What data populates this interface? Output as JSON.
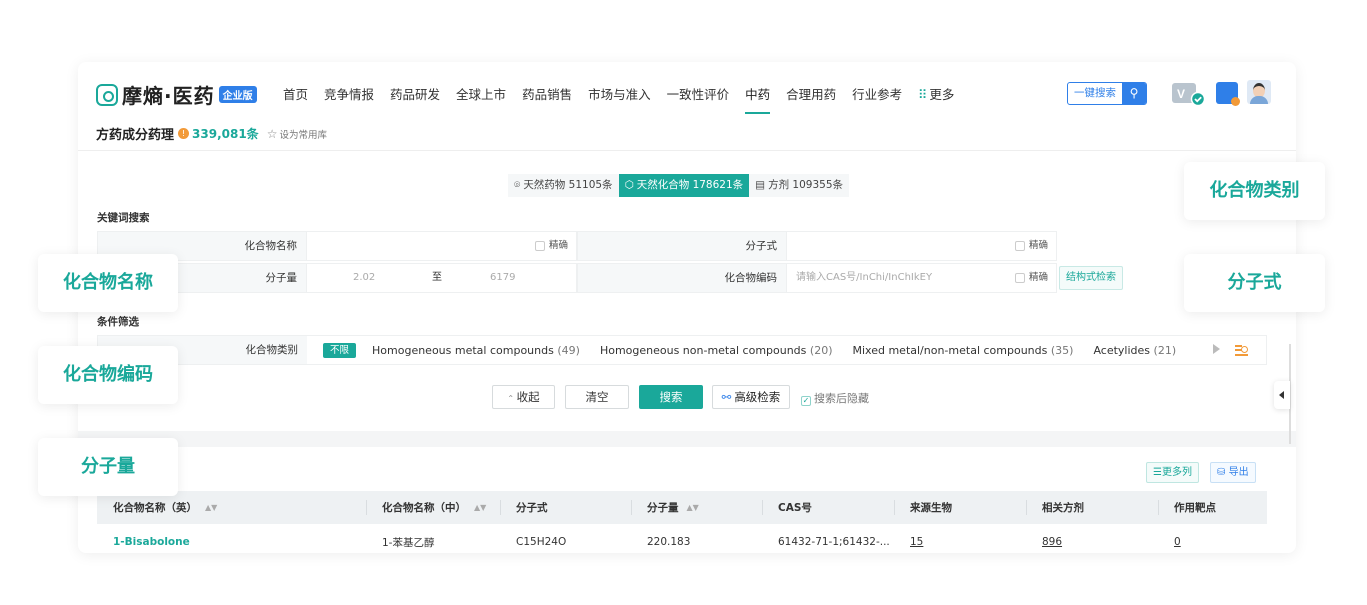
{
  "logo": {
    "name": "摩熵·医药",
    "badge": "企业版"
  },
  "nav": {
    "items": [
      "首页",
      "竞争情报",
      "药品研发",
      "全球上市",
      "药品销售",
      "市场与准入",
      "一致性评价",
      "中药",
      "合理用药",
      "行业参考"
    ],
    "active": "中药",
    "more": "更多"
  },
  "quick_search": {
    "label": "一键搜索"
  },
  "subheader": {
    "title": "方药成分药理",
    "count": "339,081条",
    "fav": "设为常用库"
  },
  "type_tabs": [
    {
      "label": "天然药物 51105条",
      "active": false
    },
    {
      "label": "天然化合物 178621条",
      "active": true
    },
    {
      "label": "方剂 109355条",
      "active": false
    }
  ],
  "keyword_section": "关键词搜索",
  "fields": {
    "compound_name": "化合物名称",
    "precise": "精确",
    "formula": "分子式",
    "mw": "分子量",
    "mw_min": "2.02",
    "mw_to": "至",
    "mw_max": "6179",
    "code": "化合物编码",
    "code_placeholder": "请输入CAS号/InChi/InChIkEY",
    "struct_search": "结构式检索"
  },
  "filter_section": "条件筛选",
  "filter": {
    "label": "化合物类别",
    "unlimited": "不限",
    "options": [
      {
        "name": "Homogeneous metal compounds",
        "count": "(49)"
      },
      {
        "name": "Homogeneous non-metal compounds",
        "count": "(20)"
      },
      {
        "name": "Mixed metal/non-metal compounds",
        "count": "(35)"
      },
      {
        "name": "Acetylides",
        "count": "(21)"
      }
    ]
  },
  "actions": {
    "collapse": "收起",
    "clear": "清空",
    "search": "搜索",
    "advanced": "高级检索",
    "hide_after": "搜索后隐藏"
  },
  "table_tools": {
    "more_cols": "更多列",
    "export": "导出"
  },
  "table": {
    "headers": [
      "化合物名称（英）",
      "化合物名称（中）",
      "分子式",
      "分子量",
      "CAS号",
      "来源生物",
      "相关方剂",
      "作用靶点"
    ],
    "rows": [
      [
        "1-Bisabolone",
        "1-苯基乙醇",
        "C15H24O",
        "220.183",
        "61432-71-1;61432-...",
        "15",
        "896",
        "0"
      ]
    ]
  },
  "float_tags": [
    "化合物类别",
    "化合物名称",
    "分子式",
    "化合物编码",
    "分子量"
  ],
  "colors": {
    "accent": "#1aa89a",
    "blue": "#2f7fe8",
    "orange": "#f29a38"
  }
}
